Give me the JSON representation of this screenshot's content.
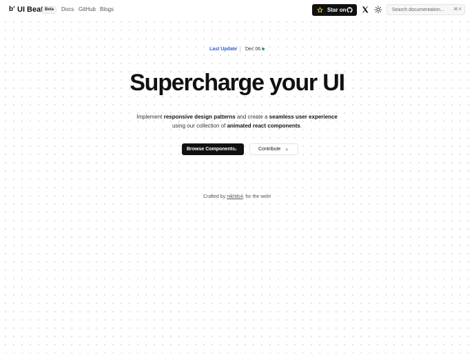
{
  "header": {
    "logo_mark": "b'",
    "brand": "UI Beats",
    "badge": "Beta",
    "nav": [
      {
        "label": "Docs"
      },
      {
        "label": "GitHub"
      },
      {
        "label": "Blogs"
      }
    ],
    "star_button_label": "Star on",
    "search": {
      "placeholder": "Search documentation...",
      "shortcut": "⌘ K"
    }
  },
  "hero": {
    "last_update_label": "Last Update",
    "last_update_date": "Dec 06",
    "headline": "Supercharge your UI",
    "subtext": {
      "p1": "Implement ",
      "b1": "responsive design patterns",
      "p2": " and create a ",
      "b2": "seamless user experience",
      "p3": " using our collection of ",
      "b3": "animated react components",
      "p4": "."
    },
    "primary_button": "Browse Components",
    "secondary_button": "Contribute"
  },
  "footer": {
    "prefix": "Crafted by ",
    "author": "nikhils4",
    "suffix": ", for the web!"
  },
  "colors": {
    "accent_blue": "#2f5fd0",
    "status_green": "#22a45b",
    "dark": "#111111"
  },
  "icons": {
    "star": "star-icon",
    "github": "github-icon",
    "x": "x-logo-icon",
    "theme": "sun-icon",
    "chevron": "chevron-right-icon"
  }
}
